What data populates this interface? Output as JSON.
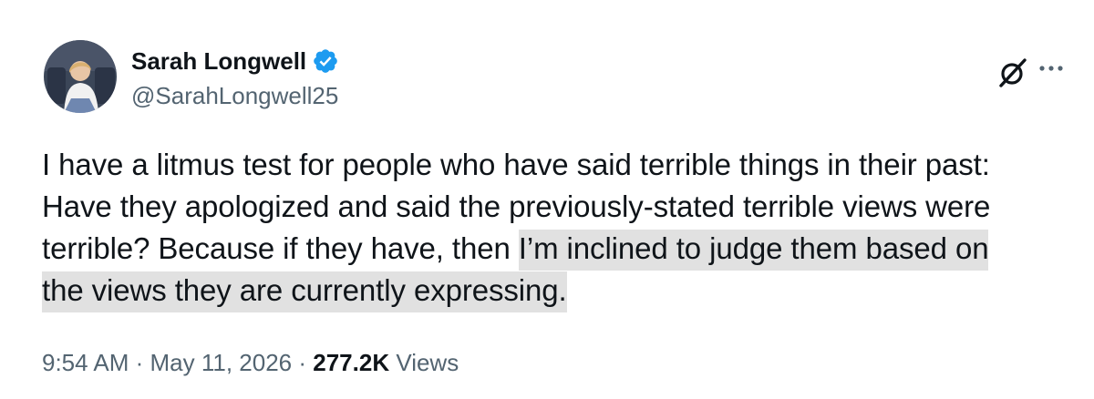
{
  "author": {
    "name": "Sarah Longwell",
    "handle": "@SarahLongwell25",
    "verified": true
  },
  "tweet": {
    "text_line_1": "I have a litmus test for people who have said terrible things in their past:",
    "text_line_2": "Have they apologized and said the previously-stated terrible views were",
    "text_line_3_plain": "terrible? Because if they have, then ",
    "text_line_3_highlight": "I’m inclined to judge them based on",
    "text_line_4_highlight": "the views they are currently expressing."
  },
  "meta": {
    "time": "9:54 AM",
    "separator_1": " · ",
    "date": "May 11, 2026",
    "separator_2": " · ",
    "views_count": "277.2K",
    "views_label": " Views"
  },
  "icons": {
    "verified": "verified-badge-icon",
    "grok": "grok-icon",
    "more": "more-options-icon"
  },
  "colors": {
    "text": "#0f1419",
    "secondary": "#536471",
    "verified": "#1d9bf0",
    "highlight": "#e1e1e1"
  }
}
